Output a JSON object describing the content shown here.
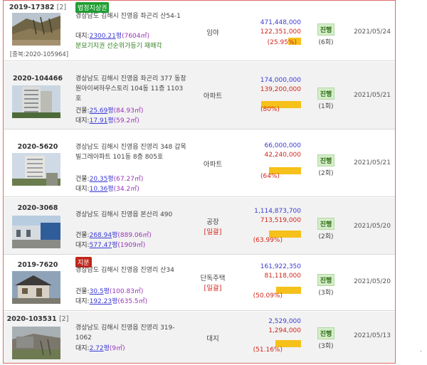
{
  "rows": [
    {
      "case": "2019-17382",
      "count": "[2]",
      "dup": "[중복:2020-105964]",
      "badge": "법정지상권",
      "badge_color": "#1e9e32",
      "address": "경상남도 김해시 진영읍 좌곤리 산54-1",
      "land_label": "대지:",
      "land_area": "2300.21",
      "land_unit": "평",
      "land_sub": "(7604㎡)",
      "note": "분묘기지권 선순위가등기 재매각",
      "usage": "임야",
      "appraisal": "471,448,000",
      "min_bid": "122,351,000",
      "ratio": "(25.95%)",
      "ratio_value": 25.95,
      "status": "진행",
      "round": "(6회)",
      "date": "2021/05/24"
    },
    {
      "case": "2020-104466",
      "address": "경상남도 김해시 진영읍 좌곤리 377 동창원아이써하우스토리 104동 11층 1103호",
      "bld_label": "건물:",
      "bld_area": "25.69",
      "bld_unit": "평",
      "bld_sub": "(84.93㎡)",
      "land_label": "대지:",
      "land_area": "17.91",
      "land_unit": "평",
      "land_sub": "(59.2㎡)",
      "usage": "아파트",
      "appraisal": "174,000,000",
      "min_bid": "139,200,000",
      "ratio": "(80%)",
      "ratio_value": 80,
      "status": "진행",
      "round": "(1회)",
      "date": "2021/05/21"
    },
    {
      "case": "2020-5620",
      "address": "경상남도 김해시 진영읍 진영리 348 갑목빌그레아파트 101동 8층 805호",
      "bld_label": "건물:",
      "bld_area": "20.35",
      "bld_unit": "평",
      "bld_sub": "(67.27㎡)",
      "land_label": "대지:",
      "land_area": "10.36",
      "land_unit": "평",
      "land_sub": "(34.2㎡)",
      "usage": "아파트",
      "appraisal": "66,000,000",
      "min_bid": "42,240,000",
      "ratio": "(64%)",
      "ratio_value": 64,
      "status": "진행",
      "round": "(2회)",
      "date": "2021/05/21"
    },
    {
      "case": "2020-3068",
      "address": "경상남도 김해시 진영읍 본산리 490",
      "bld_label": "건물:",
      "bld_area": "268.94",
      "bld_unit": "평",
      "bld_sub": "(889.06㎡)",
      "land_label": "대지:",
      "land_area": "577.47",
      "land_unit": "평",
      "land_sub": "(1909㎡)",
      "usage": "공장",
      "bulk": "[일괄]",
      "appraisal": "1,114,873,700",
      "min_bid": "713,519,000",
      "ratio": "(63.99%)",
      "ratio_value": 63.99,
      "status": "진행",
      "round": "(2회)",
      "date": "2021/05/20"
    },
    {
      "case": "2019-7620",
      "badge": "지분",
      "badge_color": "#c0261b",
      "address": "경상남도 김해시 진영읍 진영리 산34",
      "bld_label": "건물:",
      "bld_area": "30.5",
      "bld_unit": "평",
      "bld_sub": "(100.83㎡)",
      "land_label": "대지:",
      "land_area": "192.23",
      "land_unit": "평",
      "land_sub": "(635.5㎡)",
      "usage": "단독주택",
      "bulk": "[일괄]",
      "appraisal": "161,922,350",
      "min_bid": "81,118,000",
      "ratio": "(50.09%)",
      "ratio_value": 50.09,
      "status": "진행",
      "round": "(3회)",
      "date": "2021/05/20"
    },
    {
      "case": "2020-103531",
      "count": "[2]",
      "address": "경상남도 김해시 진영읍 진영리 319-1062",
      "land_label": "대지:",
      "land_area": "2.72",
      "land_unit": "평",
      "land_sub": "(9㎡)",
      "usage": "대지",
      "appraisal": "2,529,000",
      "min_bid": "1,294,000",
      "ratio": "(51.16%)",
      "ratio_value": 51.16,
      "status": "진행",
      "round": "(3회)",
      "date": "2021/05/13"
    }
  ],
  "footer_mark": "."
}
